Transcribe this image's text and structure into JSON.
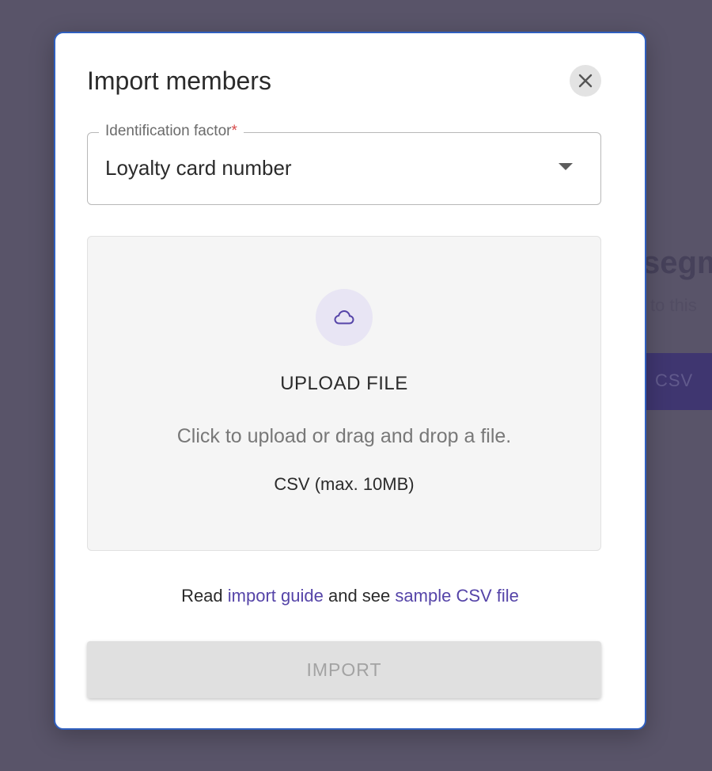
{
  "background": {
    "heading": "segm",
    "subtext": "to this",
    "button_label": "CSV"
  },
  "modal": {
    "title": "Import members",
    "close_icon": "close-icon",
    "identification": {
      "label": "Identification factor",
      "required_mark": "*",
      "value": "Loyalty card number",
      "arrow_icon": "dropdown-arrow-icon"
    },
    "upload": {
      "icon": "cloud-icon",
      "title": "UPLOAD FILE",
      "hint": "Click to upload or drag and drop a file.",
      "format": "CSV (max. 10MB)"
    },
    "help": {
      "prefix": "Read",
      "guide_link": "import guide",
      "middle": "and see",
      "sample_link": "sample CSV file"
    },
    "import_button": "IMPORT"
  },
  "colors": {
    "overlay": "#595469",
    "modal_border": "#2f5fbf",
    "link": "#5544a8",
    "required": "#d84a4a",
    "icon_accent": "#5544a8",
    "disabled_button": "#e0e0e0"
  }
}
